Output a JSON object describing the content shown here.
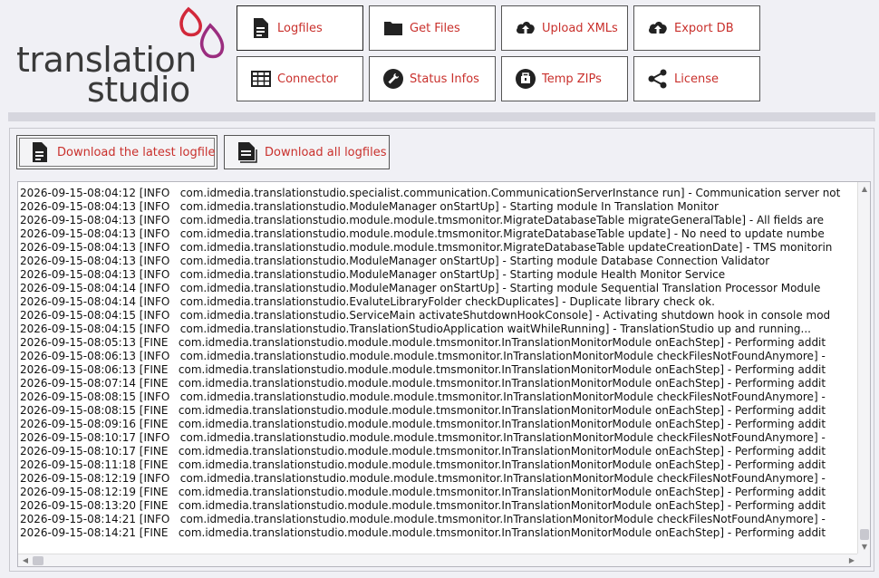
{
  "brand": {
    "line1": "translation",
    "line2": "studio",
    "accent": "#d2283a",
    "accent2": "#9b2d7f"
  },
  "nav": [
    {
      "label": "Logfiles",
      "icon": "file-document-icon"
    },
    {
      "label": "Get Files",
      "icon": "folder-icon"
    },
    {
      "label": "Upload XMLs",
      "icon": "cloud-upload-icon"
    },
    {
      "label": "Export DB",
      "icon": "cloud-upload-icon"
    },
    {
      "label": "Connector",
      "icon": "table-grid-icon"
    },
    {
      "label": "Status Infos",
      "icon": "wrench-icon"
    },
    {
      "label": "Temp ZIPs",
      "icon": "zip-icon"
    },
    {
      "label": "License",
      "icon": "share-icon"
    }
  ],
  "download": {
    "latest_label": "Download the latest logfile",
    "all_label": "Download all logfiles"
  },
  "log": {
    "lines": [
      "2026-09-15-08:04:12 [INFO   com.idmedia.translationstudio.specialist.communication.CommunicationServerInstance run] - Communication server not",
      "2026-09-15-08:04:13 [INFO   com.idmedia.translationstudio.ModuleManager onStartUp] - Starting module In Translation Monitor",
      "2026-09-15-08:04:13 [INFO   com.idmedia.translationstudio.module.module.tmsmonitor.MigrateDatabaseTable migrateGeneralTable] - All fields are",
      "2026-09-15-08:04:13 [INFO   com.idmedia.translationstudio.module.module.tmsmonitor.MigrateDatabaseTable update] - No need to update numbe",
      "2026-09-15-08:04:13 [INFO   com.idmedia.translationstudio.module.module.tmsmonitor.MigrateDatabaseTable updateCreationDate] - TMS monitorin",
      "2026-09-15-08:04:13 [INFO   com.idmedia.translationstudio.ModuleManager onStartUp] - Starting module Database Connection Validator",
      "2026-09-15-08:04:13 [INFO   com.idmedia.translationstudio.ModuleManager onStartUp] - Starting module Health Monitor Service",
      "2026-09-15-08:04:14 [INFO   com.idmedia.translationstudio.ModuleManager onStartUp] - Starting module Sequential Translation Processor Module",
      "2026-09-15-08:04:14 [INFO   com.idmedia.translationstudio.EvaluteLibraryFolder checkDuplicates] - Duplicate library check ok.",
      "2026-09-15-08:04:15 [INFO   com.idmedia.translationstudio.ServiceMain activateShutdownHookConsole] - Activating shutdown hook in console mod",
      "2026-09-15-08:04:15 [INFO   com.idmedia.translationstudio.TranslationStudioApplication waitWhileRunning] - TranslationStudio up and running...",
      "2026-09-15-08:05:13 [FINE   com.idmedia.translationstudio.module.module.tmsmonitor.InTranslationMonitorModule onEachStep] - Performing addit",
      "2026-09-15-08:06:13 [INFO   com.idmedia.translationstudio.module.module.tmsmonitor.InTranslationMonitorModule checkFilesNotFoundAnymore] -",
      "2026-09-15-08:06:13 [FINE   com.idmedia.translationstudio.module.module.tmsmonitor.InTranslationMonitorModule onEachStep] - Performing addit",
      "2026-09-15-08:07:14 [FINE   com.idmedia.translationstudio.module.module.tmsmonitor.InTranslationMonitorModule onEachStep] - Performing addit",
      "2026-09-15-08:08:15 [INFO   com.idmedia.translationstudio.module.module.tmsmonitor.InTranslationMonitorModule checkFilesNotFoundAnymore] -",
      "2026-09-15-08:08:15 [FINE   com.idmedia.translationstudio.module.module.tmsmonitor.InTranslationMonitorModule onEachStep] - Performing addit",
      "2026-09-15-08:09:16 [FINE   com.idmedia.translationstudio.module.module.tmsmonitor.InTranslationMonitorModule onEachStep] - Performing addit",
      "2026-09-15-08:10:17 [INFO   com.idmedia.translationstudio.module.module.tmsmonitor.InTranslationMonitorModule checkFilesNotFoundAnymore] -",
      "2026-09-15-08:10:17 [FINE   com.idmedia.translationstudio.module.module.tmsmonitor.InTranslationMonitorModule onEachStep] - Performing addit",
      "2026-09-15-08:11:18 [FINE   com.idmedia.translationstudio.module.module.tmsmonitor.InTranslationMonitorModule onEachStep] - Performing addit",
      "2026-09-15-08:12:19 [INFO   com.idmedia.translationstudio.module.module.tmsmonitor.InTranslationMonitorModule checkFilesNotFoundAnymore] -",
      "2026-09-15-08:12:19 [FINE   com.idmedia.translationstudio.module.module.tmsmonitor.InTranslationMonitorModule onEachStep] - Performing addit",
      "2026-09-15-08:13:20 [FINE   com.idmedia.translationstudio.module.module.tmsmonitor.InTranslationMonitorModule onEachStep] - Performing addit",
      "2026-09-15-08:14:21 [INFO   com.idmedia.translationstudio.module.module.tmsmonitor.InTranslationMonitorModule checkFilesNotFoundAnymore] -",
      "2026-09-15-08:14:21 [FINE   com.idmedia.translationstudio.module.module.tmsmonitor.InTranslationMonitorModule onEachStep] - Performing addit"
    ]
  }
}
